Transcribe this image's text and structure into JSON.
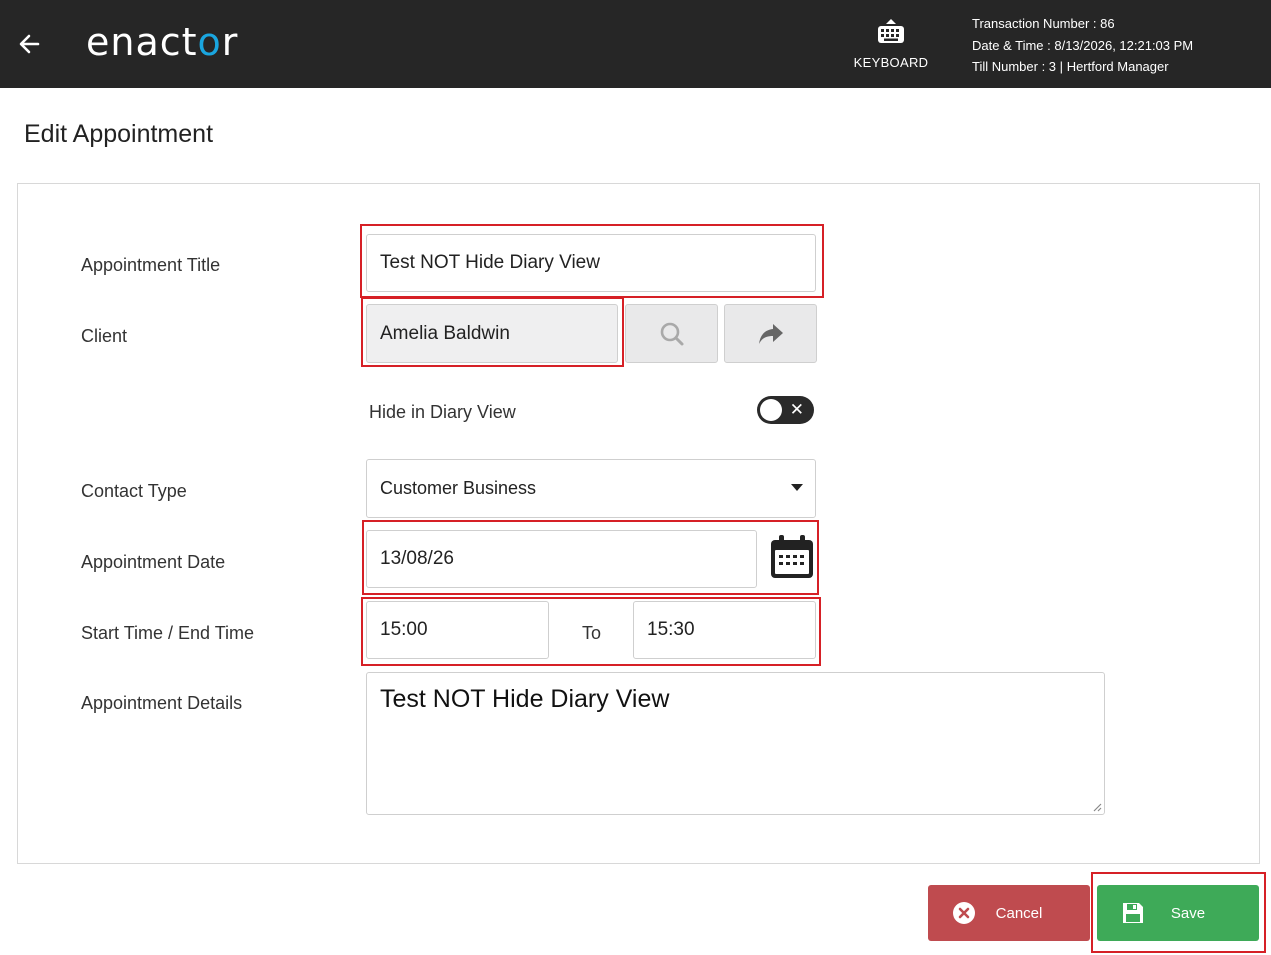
{
  "header": {
    "logo_text_a": "enact",
    "logo_text_o": "o",
    "logo_text_b": "r",
    "keyboard_label": "KEYBOARD",
    "transaction_number": "Transaction Number : 86",
    "date_time": "Date & Time : 8/13/2026, 12:21:03 PM",
    "till_number": "Till Number : 3",
    "separator": "|",
    "store": "Hertford Manager"
  },
  "page": {
    "title": "Edit Appointment"
  },
  "form": {
    "appointment_title": {
      "label": "Appointment Title",
      "value": "Test NOT Hide Diary View"
    },
    "client": {
      "label": "Client",
      "value": "Amelia Baldwin"
    },
    "hide_in_diary": {
      "label": "Hide in Diary View",
      "on": false,
      "off_glyph": "✕"
    },
    "contact_type": {
      "label": "Contact Type",
      "value": "Customer Business"
    },
    "appointment_date": {
      "label": "Appointment Date",
      "value": "13/08/26"
    },
    "time": {
      "label": "Start Time / End Time",
      "start": "15:00",
      "separator": "To",
      "end": "15:30"
    },
    "details": {
      "label": "Appointment Details",
      "value": "Test NOT Hide Diary View"
    }
  },
  "actions": {
    "cancel_label": "Cancel",
    "save_label": "Save"
  },
  "colors": {
    "topbar": "#262626",
    "accent_logo": "#1aa6e0",
    "cancel": "#bf4b4f",
    "save": "#3eaa58",
    "highlight": "#d62026"
  }
}
